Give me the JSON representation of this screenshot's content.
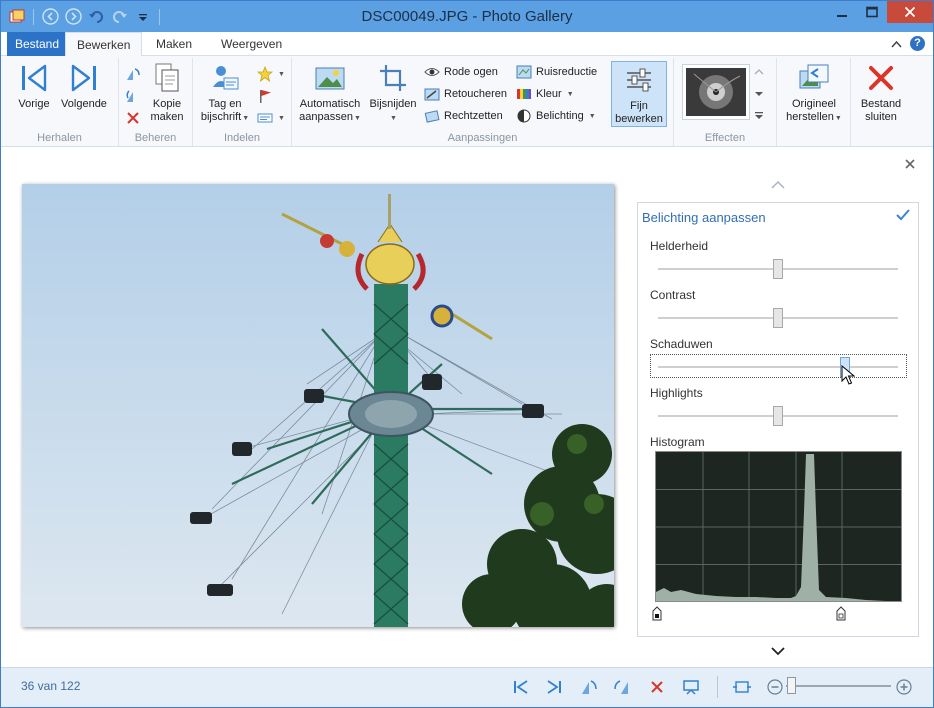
{
  "window": {
    "title": "DSC00049.JPG - Photo Gallery"
  },
  "menu": {
    "tabs": [
      {
        "label": "Bestand"
      },
      {
        "label": "Bewerken"
      },
      {
        "label": "Maken"
      },
      {
        "label": "Weergeven"
      }
    ]
  },
  "ribbon": {
    "groups": {
      "herhalen": "Herhalen",
      "beheren": "Beheren",
      "indelen": "Indelen",
      "aanpassingen": "Aanpassingen",
      "effecten": "Effecten"
    },
    "vorige": "Vorige",
    "volgende": "Volgende",
    "kopie_1": "Kopie",
    "kopie_2": "maken",
    "tag_1": "Tag en",
    "tag_2": "bijschrift",
    "auto_1": "Automatisch",
    "auto_2": "aanpassen",
    "bijsnijden": "Bijsnijden",
    "rode_ogen": "Rode ogen",
    "retoucheren": "Retoucheren",
    "rechtzetten": "Rechtzetten",
    "ruisreductie": "Ruisreductie",
    "kleur": "Kleur",
    "belichting": "Belichting",
    "fijn_1": "Fijn",
    "fijn_2": "bewerken",
    "origineel_1": "Origineel",
    "origineel_2": "herstellen",
    "sluiten_1": "Bestand",
    "sluiten_2": "sluiten"
  },
  "panel": {
    "title": "Belichting aanpassen",
    "sliders": [
      {
        "label": "Helderheid",
        "value": 0.5
      },
      {
        "label": "Contrast",
        "value": 0.5
      },
      {
        "label": "Schaduwen",
        "value": 0.78
      },
      {
        "label": "Highlights",
        "value": 0.5
      }
    ],
    "histogram_label": "Histogram"
  },
  "status": {
    "count": "36 van 122"
  },
  "colors": {
    "accent": "#2c72c7",
    "titlebar": "#5aa0e3",
    "close": "#c74a3a",
    "delete": "#d9352b"
  }
}
